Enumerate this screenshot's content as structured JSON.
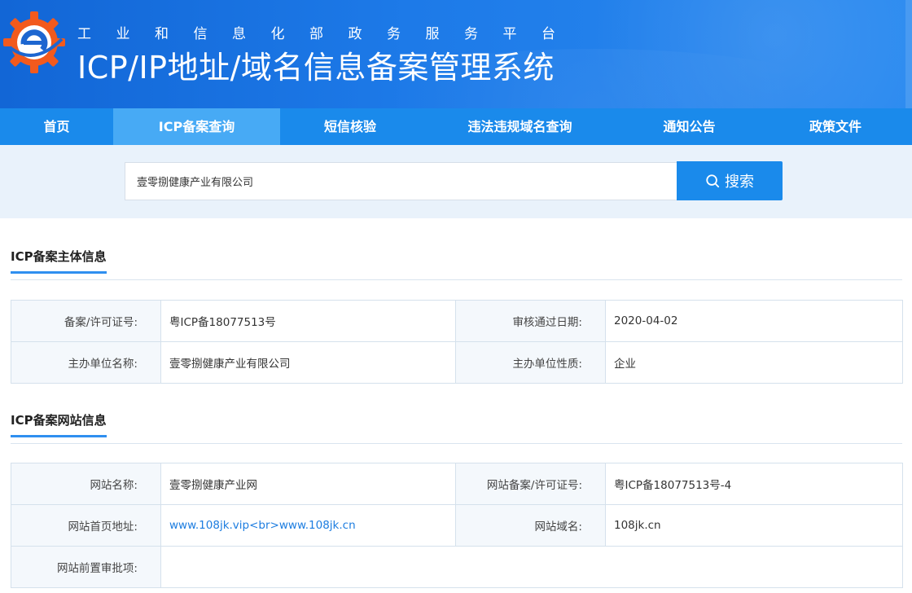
{
  "header": {
    "subtitle": "工业和信息化部政务服务平台",
    "title": "ICP/IP地址/域名信息备案管理系统"
  },
  "nav": {
    "items": [
      {
        "label": "首页",
        "active": false
      },
      {
        "label": "ICP备案查询",
        "active": true
      },
      {
        "label": "短信核验",
        "active": false
      },
      {
        "label": "违法违规域名查询",
        "active": false
      },
      {
        "label": "通知公告",
        "active": false
      },
      {
        "label": "政策文件",
        "active": false
      }
    ]
  },
  "search": {
    "value": "壹零捌健康产业有限公司",
    "button_label": "搜索"
  },
  "subject_section": {
    "heading": "ICP备案主体信息",
    "rows": [
      {
        "k1": "备案/许可证号:",
        "v1": "粤ICP备18077513号",
        "k2": "审核通过日期:",
        "v2": "2020-04-02"
      },
      {
        "k1": "主办单位名称:",
        "v1": "壹零捌健康产业有限公司",
        "k2": "主办单位性质:",
        "v2": "企业"
      }
    ]
  },
  "website_section": {
    "heading": "ICP备案网站信息",
    "rows": [
      {
        "k1": "网站名称:",
        "v1": "壹零捌健康产业网",
        "k2": "网站备案/许可证号:",
        "v2": "粤ICP备18077513号-4"
      },
      {
        "k1": "网站首页地址:",
        "v1": "www.108jk.vip<br>www.108jk.cn",
        "k2": "网站域名:",
        "v2": "108jk.cn"
      },
      {
        "k1": "网站前置审批项:",
        "v1": ""
      }
    ]
  },
  "colors": {
    "header_bg": "#1d7ae8",
    "nav_bg": "#1a8aeb",
    "nav_active": "#47aaf5",
    "search_band": "#e9f2fb",
    "link": "#1d7de0"
  }
}
